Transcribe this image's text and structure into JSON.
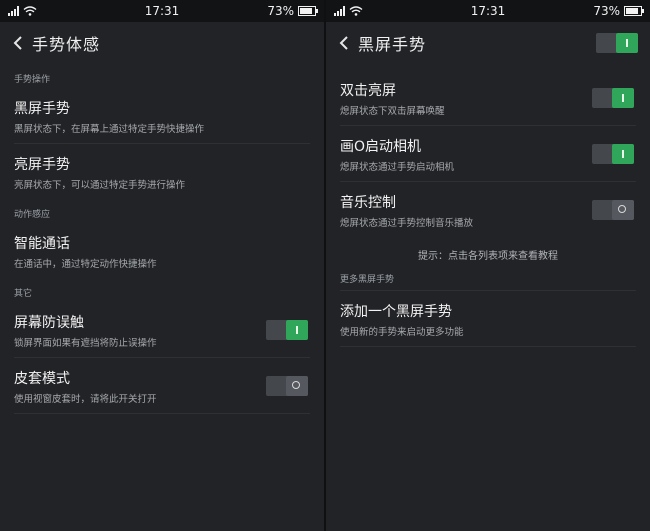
{
  "status_bar": {
    "time": "17:31",
    "battery": "73%",
    "battery_level": 0.73
  },
  "left_screen": {
    "title": "手势体感",
    "sections": [
      {
        "header": "手势操作"
      },
      {
        "header": "动作感应"
      },
      {
        "header": "其它"
      }
    ],
    "items": [
      {
        "title": "黑屏手势",
        "subtitle": "黑屏状态下，在屏幕上通过特定手势快捷操作"
      },
      {
        "title": "亮屏手势",
        "subtitle": "亮屏状态下，可以通过特定手势进行操作"
      },
      {
        "title": "智能通话",
        "subtitle": "在通话中，通过特定动作快捷操作"
      },
      {
        "title": "屏幕防误触",
        "subtitle": "锁屏界面如果有遮挡将防止误操作",
        "toggle": "on"
      },
      {
        "title": "皮套模式",
        "subtitle": "使用视窗皮套时，请将此开关打开",
        "toggle": "off"
      }
    ]
  },
  "right_screen": {
    "title": "黑屏手势",
    "master_toggle": "on",
    "items": [
      {
        "title": "双击亮屏",
        "subtitle": "熄屏状态下双击屏幕唤醒",
        "toggle": "on"
      },
      {
        "title": "画O启动相机",
        "subtitle": "熄屏状态通过手势启动相机",
        "toggle": "on"
      },
      {
        "title": "音乐控制",
        "subtitle": "熄屏状态通过手势控制音乐播放",
        "toggle": "off"
      }
    ],
    "hint": "提示：点击各列表项来查看教程",
    "section_header": "更多黑屏手势",
    "add_item": {
      "title": "添加一个黑屏手势",
      "subtitle": "使用新的手势来启动更多功能"
    }
  },
  "icons": {
    "back": "chevron-left-icon",
    "signal": "signal-icon",
    "wifi": "wifi-icon",
    "battery": "battery-icon"
  }
}
